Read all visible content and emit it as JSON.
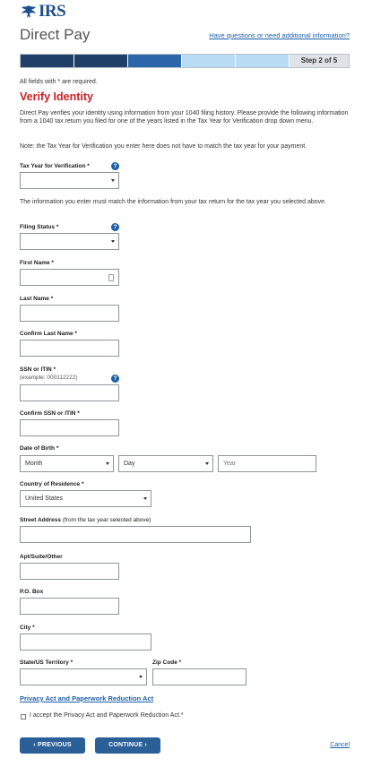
{
  "header": {
    "logo_text": "IRS",
    "app_title": "Direct Pay",
    "help_link": "Have questions or need additional information?"
  },
  "progress": {
    "step_label": "Step 2 of 5",
    "completed_segments": 2,
    "total_segments": 5
  },
  "form": {
    "required_note": "All fields with * are required.",
    "section_title": "Verify Identity",
    "intro": "Direct Pay verifies your identity using information from your 1040 filing history. Please provide the following information from a 1040 tax return you filed for one of the years listed in the Tax Year for Verification drop down menu.",
    "note": "Note: the Tax Year for Verification you enter here does not have to match the tax year for your payment.",
    "match_note": "The information you enter must match the information from your tax return for the tax year you selected above.",
    "fields": {
      "tax_year": {
        "label": "Tax Year for Verification",
        "value": ""
      },
      "filing_status": {
        "label": "Filing Status",
        "value": ""
      },
      "first_name": {
        "label": "First Name",
        "value": ""
      },
      "last_name": {
        "label": "Last Name",
        "value": ""
      },
      "confirm_last_name": {
        "label": "Confirm Last Name",
        "value": ""
      },
      "ssn": {
        "label": "SSN or ITIN",
        "example": "(example: 000112222)",
        "value": ""
      },
      "confirm_ssn": {
        "label": "Confirm SSN or ITIN",
        "value": ""
      },
      "dob": {
        "label": "Date of Birth",
        "month": "Month",
        "day": "Day",
        "year_placeholder": "Year"
      },
      "country": {
        "label": "Country of Residence",
        "value": "United States"
      },
      "street": {
        "label": "Street Address",
        "hint": "(from the tax year selected above)",
        "value": ""
      },
      "apt": {
        "label": "Apt/Suite/Other",
        "value": ""
      },
      "po_box": {
        "label": "P.O. Box",
        "value": ""
      },
      "city": {
        "label": "City",
        "value": ""
      },
      "state": {
        "label": "State/US Territory",
        "value": ""
      },
      "zip": {
        "label": "Zip Code",
        "value": ""
      }
    },
    "required_mark": "*",
    "help_glyph": "?",
    "privacy_link": "Privacy Act and Paperwork Reduction Act",
    "accept_text": "I accept the Privacy Act and Paperwork Reduction Act.*",
    "accept_checked": false
  },
  "actions": {
    "previous": "PREVIOUS",
    "continue": "CONTINUE",
    "cancel": "Cancel"
  },
  "colors": {
    "brand_blue": "#1d4f8f",
    "link_blue": "#1d5fa8",
    "error_red": "#cd2026",
    "button_blue": "#2a5f97"
  }
}
